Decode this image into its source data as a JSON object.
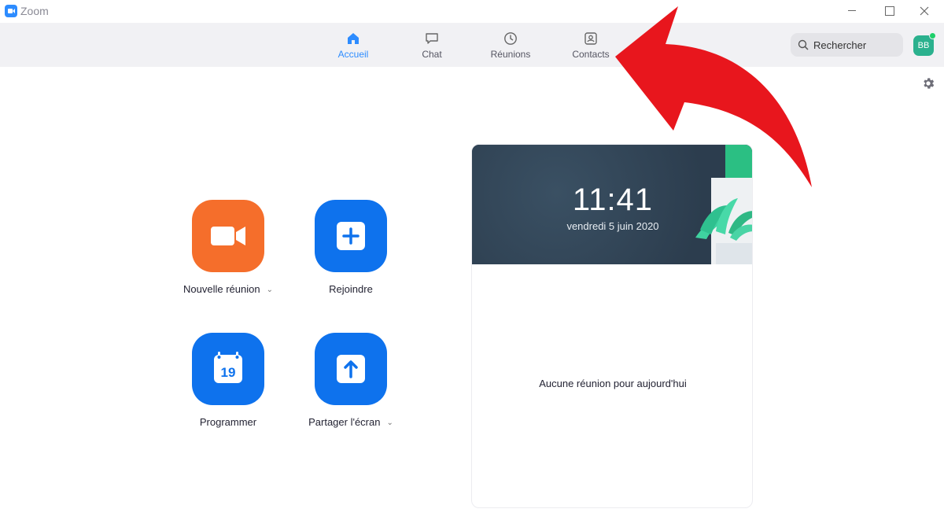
{
  "window": {
    "title": "Zoom"
  },
  "nav": {
    "tabs": [
      {
        "label": "Accueil",
        "icon": "home-icon",
        "active": true
      },
      {
        "label": "Chat",
        "icon": "chat-icon",
        "active": false
      },
      {
        "label": "Réunions",
        "icon": "clock-icon",
        "active": false
      },
      {
        "label": "Contacts",
        "icon": "contacts-icon",
        "active": false
      }
    ],
    "search_label": "Rechercher",
    "avatar_initials": "BB"
  },
  "actions": [
    {
      "label": "Nouvelle réunion",
      "icon": "video-camera-icon",
      "color": "#f56e2b",
      "has_dropdown": true
    },
    {
      "label": "Rejoindre",
      "icon": "plus-icon",
      "color": "#0e72ed",
      "has_dropdown": false
    },
    {
      "label": "Programmer",
      "icon": "calendar-icon",
      "color": "#0e72ed",
      "has_dropdown": false,
      "calendar_day": "19"
    },
    {
      "label": "Partager l'écran",
      "icon": "share-screen-icon",
      "color": "#0e72ed",
      "has_dropdown": true
    }
  ],
  "card": {
    "time": "11:41",
    "date": "vendredi 5 juin 2020",
    "empty_message": "Aucune réunion pour aujourd'hui"
  },
  "colors": {
    "accent": "#2d8cff",
    "annotation_arrow": "#e8161d"
  }
}
